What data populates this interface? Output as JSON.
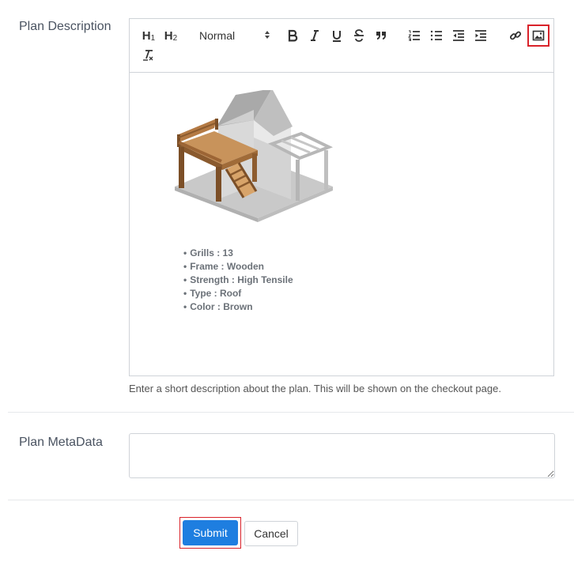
{
  "description": {
    "label": "Plan Description",
    "helper": "Enter a short description about the plan. This will be shown on the checkout page."
  },
  "toolbar": {
    "h1": "H",
    "h1_sub": "1",
    "h2": "H",
    "h2_sub": "2",
    "format_select": "Normal",
    "buttons": [
      "bold-icon",
      "italic-icon",
      "underline-icon",
      "strikethrough-icon",
      "blockquote-icon",
      "ordered-list-icon",
      "bullet-list-icon",
      "outdent-icon",
      "indent-icon",
      "link-icon",
      "image-icon",
      "clear-format-icon"
    ]
  },
  "editor_content": {
    "image_alt": "isometric house with wooden deck and pergola",
    "bullets": [
      "Grills : 13",
      "Frame : Wooden",
      "Strength : High Tensile",
      "Type : Roof",
      "Color : Brown"
    ]
  },
  "metadata": {
    "label": "Plan MetaData",
    "value": ""
  },
  "actions": {
    "submit": "Submit",
    "cancel": "Cancel"
  },
  "colors": {
    "accent": "#1e7ee0",
    "highlight": "#d9222a",
    "border": "#cfd3d8"
  }
}
